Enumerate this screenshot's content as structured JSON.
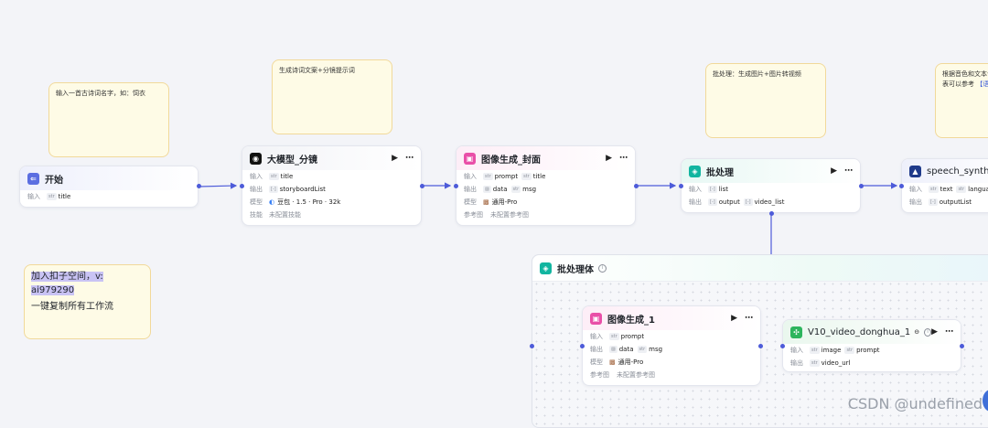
{
  "notes": [
    {
      "text": "输入一首古诗词名字，如：饲衣"
    },
    {
      "text": "生成诗词文案+分镜提示词"
    },
    {
      "text": "批处理：生成图片+图片转视频"
    },
    {
      "text": "根据音色和文本合",
      "text2": "表可以参考 ",
      "link": "【语音"
    }
  ],
  "promo": {
    "line1": "加入扣子空间，v:",
    "line2": "ai979290",
    "line3": "一键复制所有工作流"
  },
  "labels": {
    "input": "输入",
    "output": "输出",
    "model": "模型",
    "skill": "技能",
    "ref": "参考图",
    "str": "str",
    "img": "img",
    "arr": "[-]"
  },
  "nodes": {
    "start": {
      "title": "开始",
      "input_value": "title"
    },
    "llm": {
      "title": "大模型_分镜",
      "input_value": "title",
      "output_value": "storyboardList",
      "model_value": "豆包 · 1.5 · Pro · 32k",
      "skill_value": "未配置技能"
    },
    "image_cover": {
      "title": "图像生成_封面",
      "inputs": [
        "prompt",
        "title"
      ],
      "outputs": [
        "data",
        "msg"
      ],
      "model_value": "通用-Pro",
      "ref_value": "未配置参考图"
    },
    "batch": {
      "title": "批处理",
      "input_value": "list",
      "outputs": [
        "output",
        "video_list"
      ]
    },
    "speech": {
      "title": "speech_synthesis",
      "inputs": [
        "text",
        "language"
      ],
      "output_value": "outputList"
    },
    "group": {
      "title": "批处理体"
    },
    "image1": {
      "title": "图像生成_1",
      "input_value": "prompt",
      "outputs": [
        "data",
        "msg"
      ],
      "model_value": "通用-Pro",
      "ref_value": "未配置参考图"
    },
    "video": {
      "title": "V10_video_donghua_1",
      "inputs": [
        "image",
        "prompt"
      ],
      "output_value": "video_url"
    }
  },
  "icons": {
    "run": "play-icon",
    "more": "more-icon"
  },
  "colors": {
    "wire": "#4d5bd9",
    "start": "#5b6ee1",
    "image": "#e94fa8",
    "batch": "#12b5a0",
    "plugin": "#2db55d",
    "llm": "#111111"
  },
  "watermark": "CSDN @undefined"
}
